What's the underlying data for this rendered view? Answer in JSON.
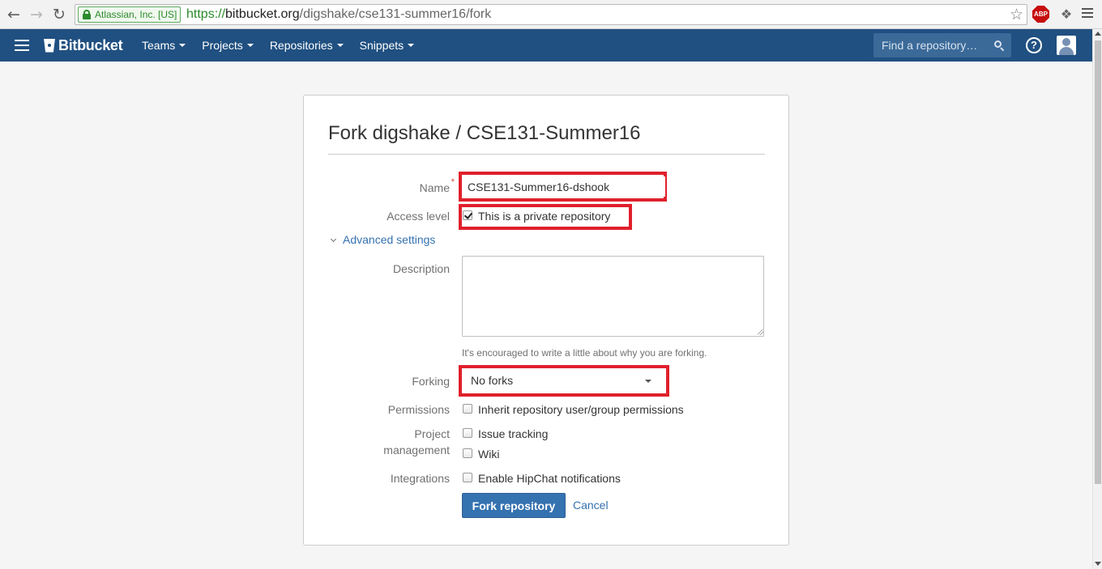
{
  "browser": {
    "ev_label": "Atlassian, Inc. [US]",
    "url_scheme": "https://",
    "url_host": "bitbucket.org",
    "url_path": "/digshake/cse131-summer16/fork",
    "adblock_label": "ABP"
  },
  "header": {
    "logo_text": "Bitbucket",
    "nav": [
      "Teams",
      "Projects",
      "Repositories",
      "Snippets"
    ],
    "search_placeholder": "Find a repository…",
    "help_glyph": "?"
  },
  "form": {
    "title": "Fork digshake / CSE131-Summer16",
    "name_label": "Name",
    "required_mark": "*",
    "name_value": "CSE131-Summer16-dshook",
    "access_label": "Access level",
    "private_label": "This is a private repository",
    "private_checked": true,
    "advanced_label": "Advanced settings",
    "description_label": "Description",
    "description_value": "",
    "description_hint": "It's encouraged to write a little about why you are forking.",
    "forking_label": "Forking",
    "forking_value": "No forks",
    "permissions_label": "Permissions",
    "permissions_option": "Inherit repository user/group permissions",
    "project_label_1": "Project",
    "project_label_2": "management",
    "issue_tracking_label": "Issue tracking",
    "wiki_label": "Wiki",
    "integrations_label": "Integrations",
    "hipchat_label": "Enable HipChat notifications",
    "submit_label": "Fork repository",
    "cancel_label": "Cancel"
  },
  "colors": {
    "header_bg": "#205081",
    "link": "#3572b0",
    "highlight": "#e0202c"
  }
}
